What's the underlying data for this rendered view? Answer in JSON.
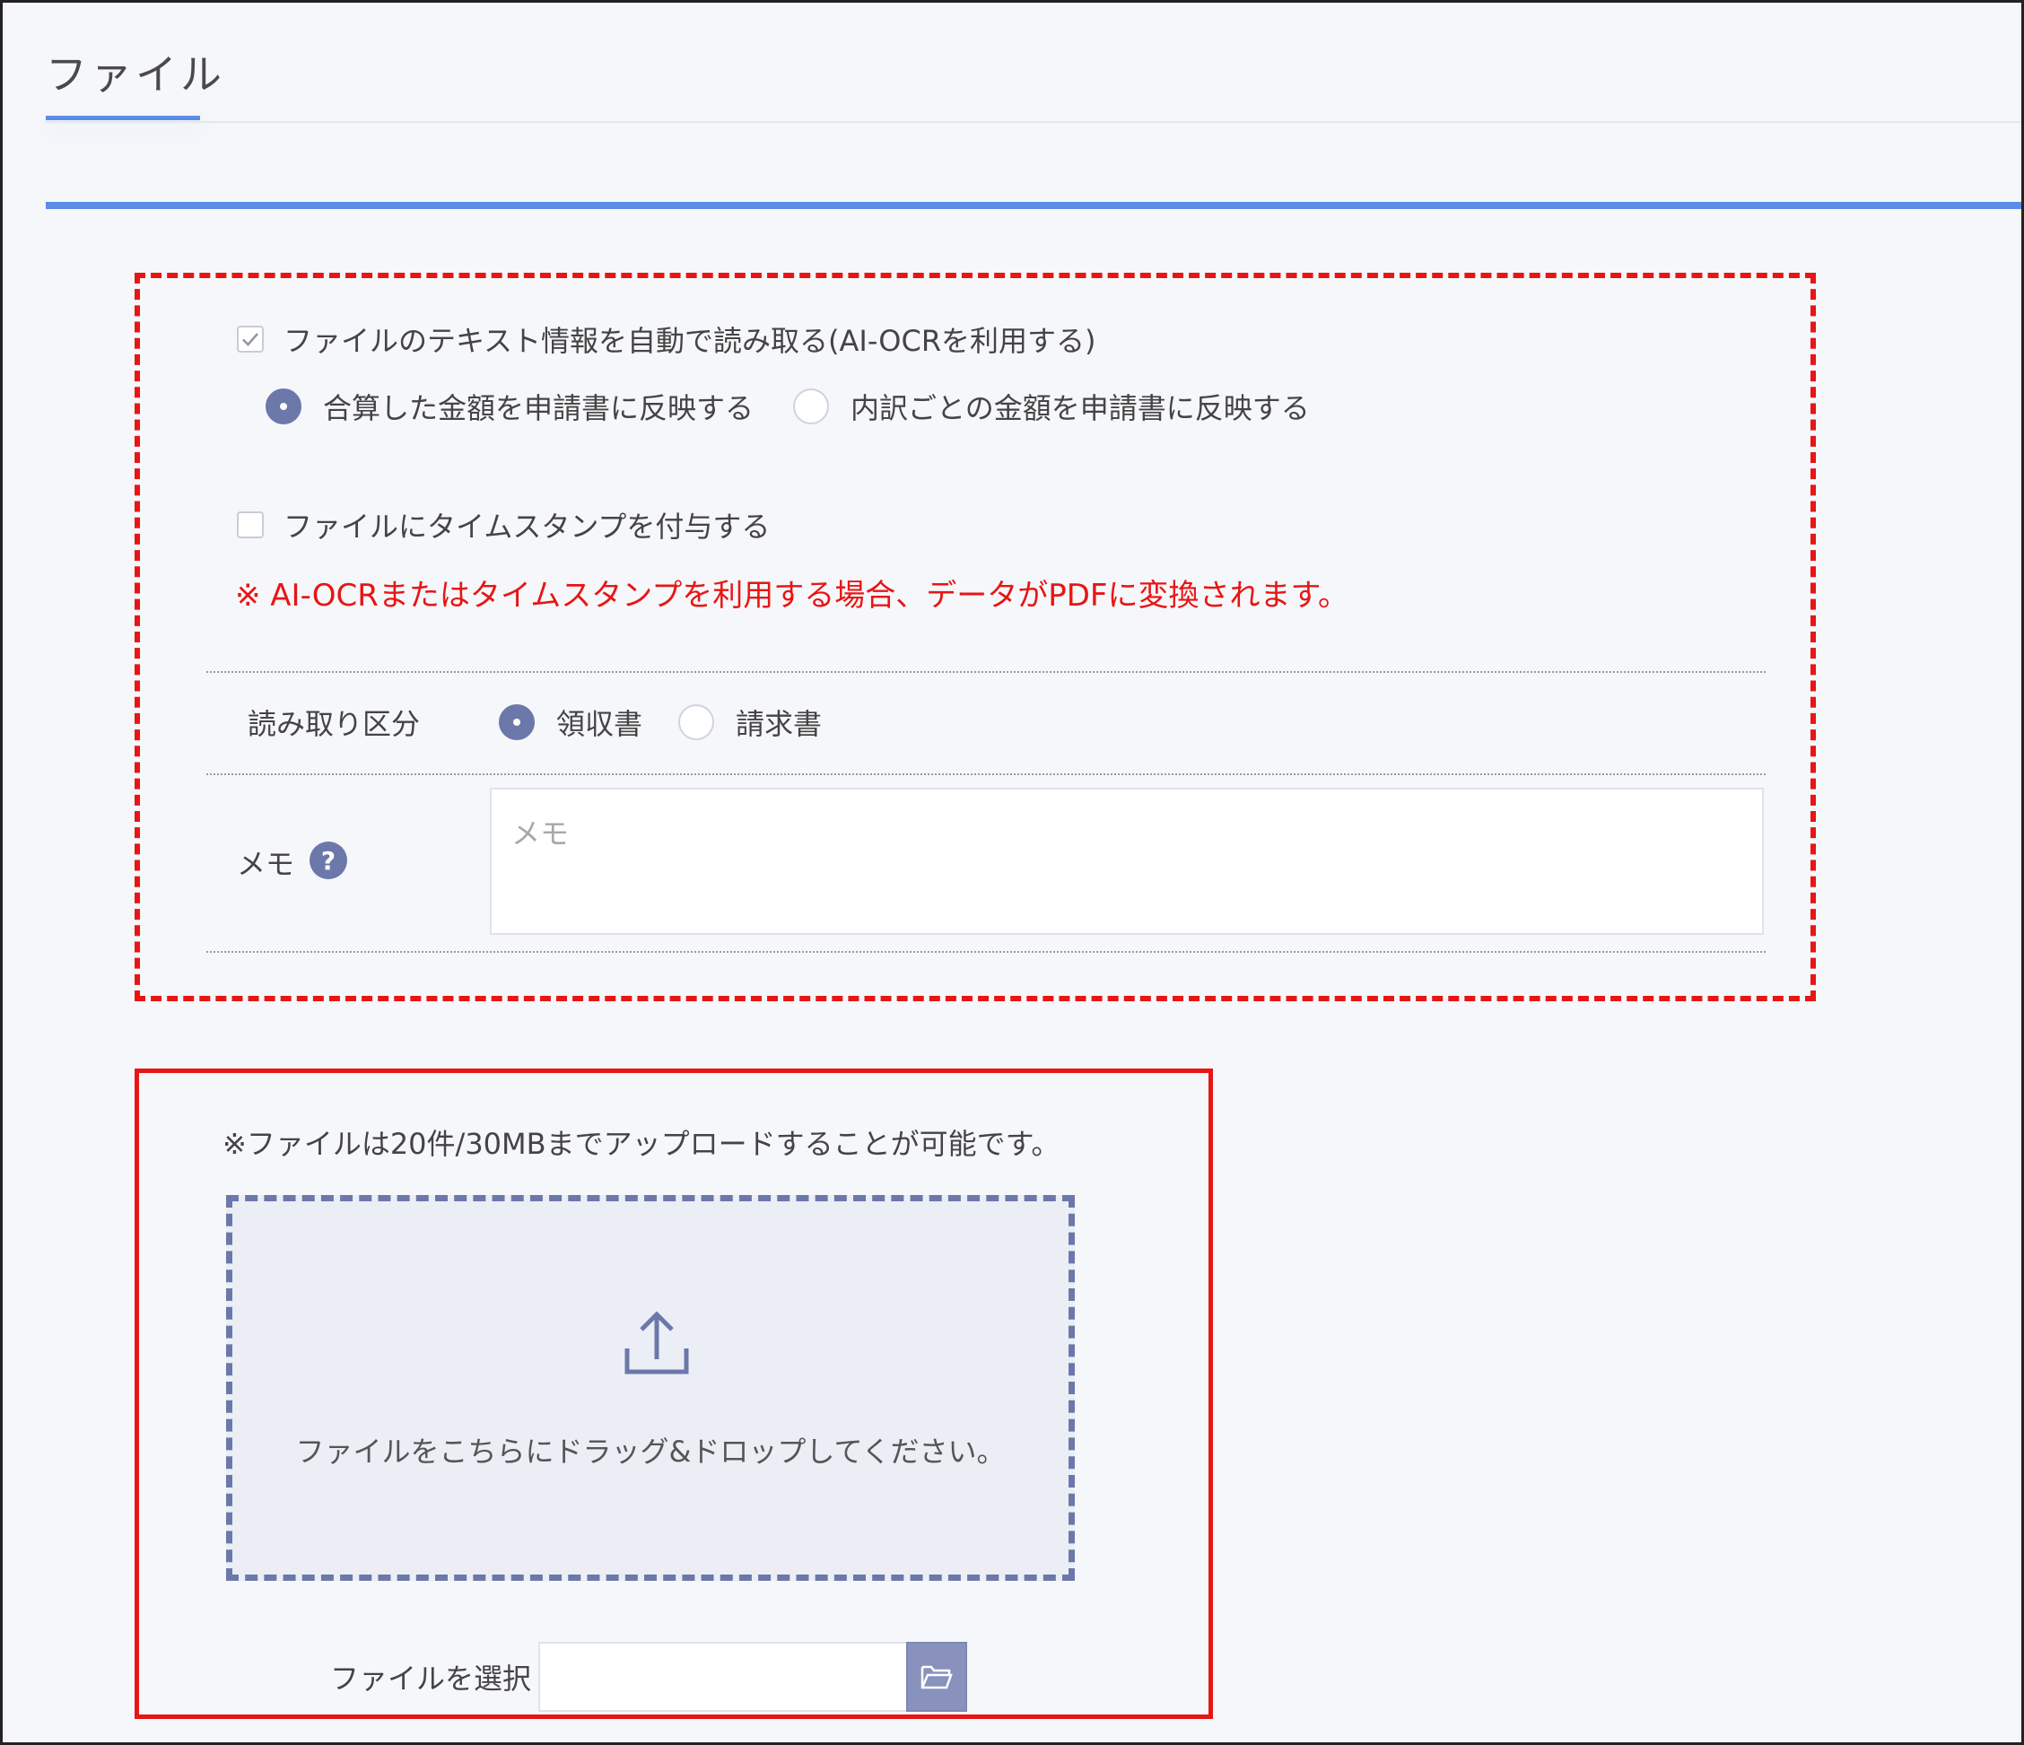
{
  "tab": {
    "label": "ファイル"
  },
  "ocr": {
    "checkbox_label": "ファイルのテキスト情報を自動で読み取る(AI-OCRを利用する)",
    "checked": true,
    "radio_sum_label": "合算した金額を申請書に反映する",
    "radio_breakdown_label": "内訳ごとの金額を申請書に反映する",
    "selected": "sum"
  },
  "timestamp": {
    "checkbox_label": "ファイルにタイムスタンプを付与する",
    "checked": false
  },
  "notice": "※ AI-OCRまたはタイムスタンプを利用する場合、データがPDFに変換されます。",
  "read_type": {
    "label": "読み取り区分",
    "options": [
      "領収書",
      "請求書"
    ],
    "selected": "領収書"
  },
  "memo": {
    "label": "メモ",
    "help": "?",
    "placeholder": "メモ",
    "value": ""
  },
  "upload": {
    "limit_text": "※ファイルは20件/30MBまでアップロードすることが可能です。",
    "drop_text": "ファイルをこちらにドラッグ&ドロップしてください。",
    "select_label": "ファイルを選択",
    "select_value": ""
  },
  "colors": {
    "accent": "#5b8de8",
    "radio_active": "#6c78aa",
    "warning": "#e81515"
  }
}
